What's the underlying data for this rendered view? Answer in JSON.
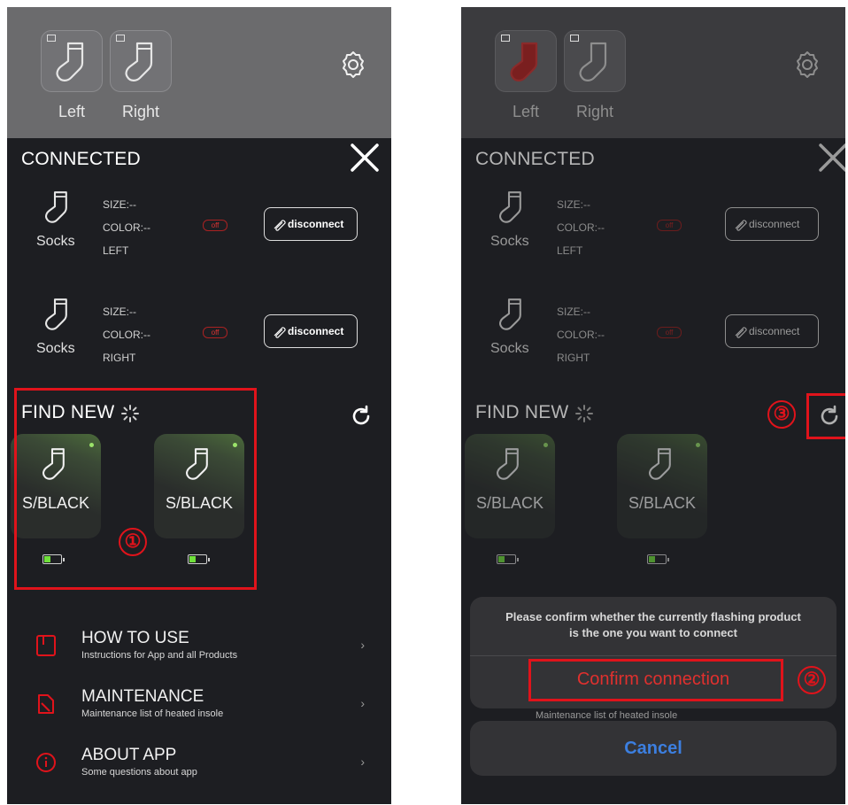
{
  "colors": {
    "accent_red": "#e0131b",
    "cancel_blue": "#3c7fe0",
    "battery_green": "#6fe03a",
    "panel_bg": "#1d1e22",
    "topbar_bg": "#6b6b6d"
  },
  "screens": [
    {
      "devices": [
        {
          "label": "Left",
          "icon": "sock-icon"
        },
        {
          "label": "Right",
          "icon": "sock-icon"
        }
      ],
      "connected_title": "CONNECTED",
      "connected": [
        {
          "type": "Socks",
          "size": "SIZE:--",
          "color": "COLOR:--",
          "side": "LEFT",
          "status": "off",
          "action": "disconnect"
        },
        {
          "type": "Socks",
          "size": "SIZE:--",
          "color": "COLOR:--",
          "side": "RIGHT",
          "status": "off",
          "action": "disconnect"
        }
      ],
      "find_title": "FIND NEW",
      "products": [
        {
          "name": "S/BLACK",
          "battery": 0.4
        },
        {
          "name": "S/BLACK",
          "battery": 0.4
        }
      ],
      "menu": [
        {
          "title": "HOW TO USE",
          "subtitle": "Instructions for App and all Products",
          "icon": "book-icon"
        },
        {
          "title": "MAINTENANCE",
          "subtitle": "Maintenance list of heated insole",
          "icon": "wrench-icon"
        },
        {
          "title": "ABOUT APP",
          "subtitle": "Some questions about app",
          "icon": "info-icon"
        }
      ],
      "annotations": [
        "①"
      ]
    },
    {
      "devices": [
        {
          "label": "Left",
          "icon": "sock-icon"
        },
        {
          "label": "Right",
          "icon": "sock-icon"
        }
      ],
      "connected_title": "CONNECTED",
      "connected": [
        {
          "type": "Socks",
          "size": "SIZE:--",
          "color": "COLOR:--",
          "side": "LEFT",
          "status": "off",
          "action": "disconnect"
        },
        {
          "type": "Socks",
          "size": "SIZE:--",
          "color": "COLOR:--",
          "side": "RIGHT",
          "status": "off",
          "action": "disconnect"
        }
      ],
      "find_title": "FIND NEW",
      "products": [
        {
          "name": "S/BLACK",
          "battery": 0.4
        },
        {
          "name": "S/BLACK",
          "battery": 0.4
        }
      ],
      "dialog": {
        "message_line1": "Please confirm whether the currently flashing product",
        "message_line2": "is the one you want to connect",
        "confirm": "Confirm connection",
        "cancel": "Cancel",
        "peek_text": "Maintenance list of heated insole"
      },
      "annotations": [
        "②",
        "③"
      ]
    }
  ]
}
